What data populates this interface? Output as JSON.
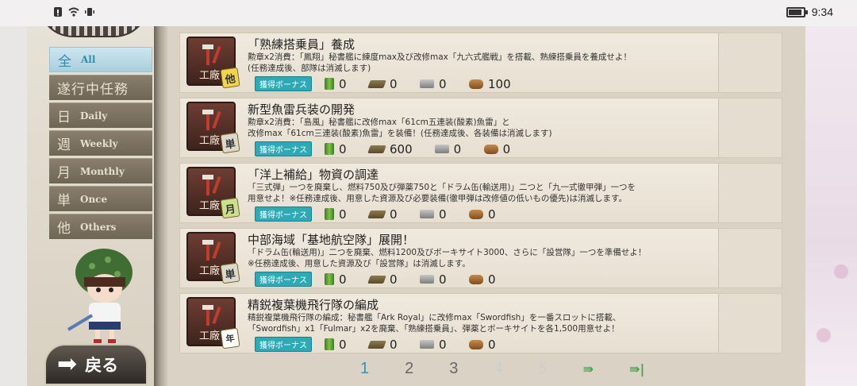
{
  "status_bar": {
    "time": "9:34"
  },
  "menu": {
    "items": [
      {
        "kanji": "全",
        "en": "All",
        "active": true
      },
      {
        "label": "遂行中任務"
      },
      {
        "kanji": "日",
        "en": "Daily"
      },
      {
        "kanji": "週",
        "en": "Weekly"
      },
      {
        "kanji": "月",
        "en": "Monthly"
      },
      {
        "kanji": "単",
        "en": "Once"
      },
      {
        "kanji": "他",
        "en": "Others"
      }
    ],
    "back_label": "戻る"
  },
  "bonus_label": "獲得ボーナス",
  "quests": [
    {
      "category": "工廠",
      "type": "他",
      "title": "「熟練搭乗員」養成",
      "desc": [
        "勲章x2消費：「鳳翔」秘書艦に練度max及び改修max「九六式艦戦」を搭載、熟練搭乗員を養成せよ！",
        "(任務達成後、部隊は消滅します)"
      ],
      "rewards": {
        "fuel": "0",
        "ammo": "0",
        "steel": "0",
        "bauxite": "100"
      }
    },
    {
      "category": "工廠",
      "type": "単",
      "title": "新型魚雷兵装の開発",
      "desc": [
        "勲章x2消費：「島風」秘書艦に改修max「61cm五連装(酸素)魚雷」と",
        "改修max「61cm三連装(酸素)魚雷」を装備！(任務達成後、各装備は消滅します)"
      ],
      "rewards": {
        "fuel": "0",
        "ammo": "600",
        "steel": "0",
        "bauxite": "0"
      }
    },
    {
      "category": "工廠",
      "type": "月",
      "title": "「洋上補給」物資の調達",
      "desc": [
        "「三式弾」一つを廃棄し、燃料750及び弾薬750と「ドラム缶(輸送用)」二つと「九一式徹甲弾」一つを",
        "用意せよ！※任務達成後、用意した資源及び必要装備(徹甲弾は改修値の低いもの優先)は消滅します。"
      ],
      "rewards": {
        "fuel": "0",
        "ammo": "0",
        "steel": "0",
        "bauxite": "0"
      }
    },
    {
      "category": "工廠",
      "type": "単",
      "title": "中部海域「基地航空隊」展開！",
      "desc": [
        "「ドラム缶(輸送用)」二つを廃棄、燃料1200及びボーキサイト3000、さらに「設営隊」一つを準備せよ！",
        "※任務達成後、用意した資源及び「設営隊」は消滅します。"
      ],
      "rewards": {
        "fuel": "0",
        "ammo": "0",
        "steel": "0",
        "bauxite": "0"
      }
    },
    {
      "category": "工廠",
      "type": "年",
      "title": "精鋭複葉機飛行隊の編成",
      "desc": [
        "精鋭複葉機飛行隊の編成：秘書艦「Ark Royal」に改修max「Swordfish」を一番スロットに搭載、",
        "「Swordfish」x1「Fulmar」x2を廃棄、「熟練搭乗員」、弾薬とボーキサイトを各1,500用意せよ！"
      ],
      "rewards": {
        "fuel": "0",
        "ammo": "0",
        "steel": "0",
        "bauxite": "0"
      }
    }
  ],
  "pagination": {
    "pages": [
      "1",
      "2",
      "3",
      "4",
      "5"
    ],
    "current": "1"
  }
}
